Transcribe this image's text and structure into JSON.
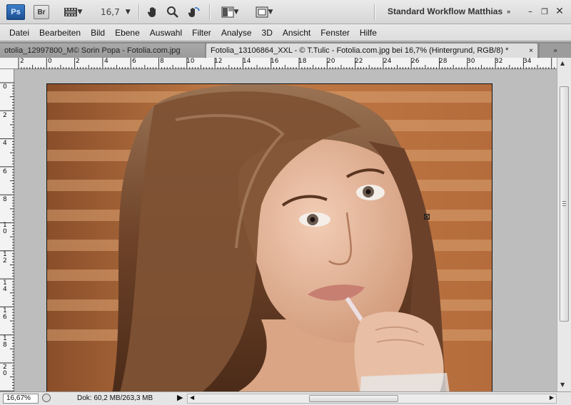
{
  "appbar": {
    "app_logo": "Ps",
    "bridge_logo": "Br",
    "zoom_value": "16,7",
    "workspace": "Standard Workflow Matthias",
    "icons": [
      "photoshop-logo",
      "bridge-icon",
      "film-strip-icon",
      "hand-tool-icon",
      "zoom-tool-icon",
      "rotate-view-icon",
      "arrange-documents-icon",
      "screen-mode-icon",
      "minimize-icon",
      "restore-icon",
      "close-icon"
    ]
  },
  "menu": [
    "Datei",
    "Bearbeiten",
    "Bild",
    "Ebene",
    "Auswahl",
    "Filter",
    "Analyse",
    "3D",
    "Ansicht",
    "Fenster",
    "Hilfe"
  ],
  "tabs": [
    {
      "label": "otolia_12997800_M© Sorin Popa - Fotolia.com.jpg",
      "active": false
    },
    {
      "label": "Fotolia_13106864_XXL - © T.Tulic - Fotolia.com.jpg bei 16,7% (Hintergrund, RGB/8) *",
      "active": true
    }
  ],
  "tab_close": "×",
  "tab_overflow": "»",
  "ruler_top": [
    "2",
    "0",
    "2",
    "4",
    "6",
    "8",
    "10",
    "12",
    "14",
    "16",
    "18",
    "20",
    "22",
    "24",
    "26",
    "28",
    "30",
    "32",
    "34"
  ],
  "ruler_left": [
    "0",
    "2",
    "4",
    "6",
    "8",
    "1 0",
    "1 2",
    "1 4",
    "1 6",
    "1 8",
    "2 0"
  ],
  "status": {
    "zoom": "16,67%",
    "doc_info": "Dok: 60,2 MB/263,3 MB"
  },
  "colors": {
    "ps_blue": "#1d4f93",
    "background_orange": "#b06a3b",
    "hair_brown": "#7a4a2a",
    "skin": "#e3b59a"
  }
}
